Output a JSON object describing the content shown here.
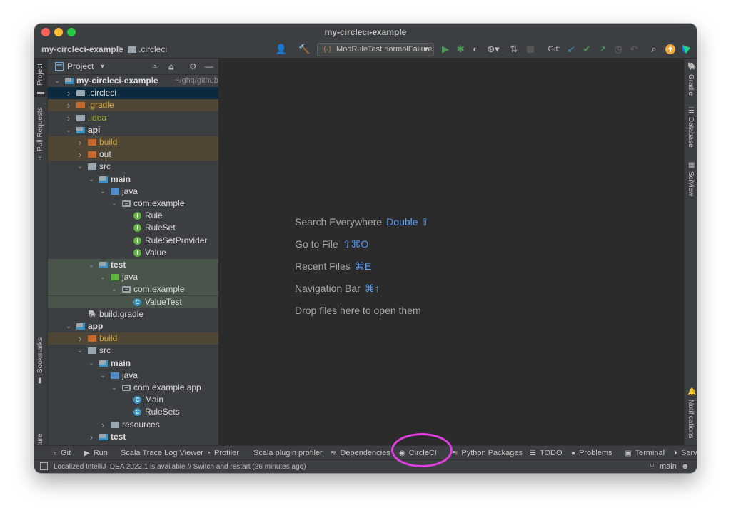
{
  "window": {
    "title": "my-circleci-example"
  },
  "toolbar": {
    "breadcrumb_project": "my-circleci-example",
    "breadcrumb_folder": ".circleci",
    "run_config": "ModRuleTest.normalFailure",
    "git_label": "Git:"
  },
  "left_strip": {
    "top": [
      "Project",
      "Pull Requests"
    ],
    "bottom": [
      "Bookmarks",
      "Structure"
    ]
  },
  "right_strip": {
    "top": [
      "Gradle",
      "Database",
      "SciView"
    ],
    "bottom": [
      "Notifications"
    ]
  },
  "project_panel": {
    "title": "Project",
    "tree": [
      {
        "label": "my-circleci-example",
        "suffix": "~/ghq/github.c",
        "depth": 0,
        "expanded": true,
        "icon": "module-folder-icon",
        "color": "#dcdcdc",
        "bold": true,
        "bg": ""
      },
      {
        "label": ".circleci",
        "depth": 1,
        "expanded": false,
        "icon": "folder-icon",
        "color": "#dcdcdc",
        "bg": "#0d293e"
      },
      {
        "label": ".gradle",
        "depth": 1,
        "expanded": false,
        "icon": "excluded-folder-icon",
        "color": "#d4a73b",
        "bg": "#4f4636"
      },
      {
        "label": ".idea",
        "depth": 1,
        "expanded": false,
        "icon": "folder-icon",
        "color": "#a1a531",
        "bg": ""
      },
      {
        "label": "api",
        "depth": 1,
        "expanded": true,
        "icon": "module-folder-icon",
        "color": "#dcdcdc",
        "bold": true,
        "bg": ""
      },
      {
        "label": "build",
        "depth": 2,
        "expanded": false,
        "icon": "excluded-folder-icon",
        "color": "#d4a73b",
        "bg": "#4f4636"
      },
      {
        "label": "out",
        "depth": 2,
        "expanded": false,
        "icon": "excluded-folder-icon",
        "color": "#dcdcdc",
        "bg": "#4f4636"
      },
      {
        "label": "src",
        "depth": 2,
        "expanded": true,
        "icon": "folder-icon",
        "color": "#dcdcdc",
        "bg": ""
      },
      {
        "label": "main",
        "depth": 3,
        "expanded": true,
        "icon": "module-folder-icon",
        "color": "#dcdcdc",
        "bold": true,
        "bg": ""
      },
      {
        "label": "java",
        "depth": 4,
        "expanded": true,
        "icon": "source-folder-icon",
        "color": "#dcdcdc",
        "bg": ""
      },
      {
        "label": "com.example",
        "depth": 5,
        "expanded": true,
        "icon": "package-icon",
        "color": "#dcdcdc",
        "bg": ""
      },
      {
        "label": "Rule",
        "depth": 6,
        "leaf": true,
        "icon": "interface-icon",
        "color": "#dcdcdc",
        "bg": ""
      },
      {
        "label": "RuleSet",
        "depth": 6,
        "leaf": true,
        "icon": "interface-icon",
        "color": "#dcdcdc",
        "bg": ""
      },
      {
        "label": "RuleSetProvider",
        "depth": 6,
        "leaf": true,
        "icon": "interface-icon",
        "color": "#dcdcdc",
        "bg": ""
      },
      {
        "label": "Value",
        "depth": 6,
        "leaf": true,
        "icon": "interface-icon",
        "color": "#dcdcdc",
        "bg": ""
      },
      {
        "label": "test",
        "depth": 3,
        "expanded": true,
        "icon": "module-folder-icon",
        "color": "#dcdcdc",
        "bold": true,
        "bg": "#49544a"
      },
      {
        "label": "java",
        "depth": 4,
        "expanded": true,
        "icon": "test-folder-icon",
        "color": "#dcdcdc",
        "bg": "#49544a"
      },
      {
        "label": "com.example",
        "depth": 5,
        "expanded": true,
        "icon": "package-icon",
        "color": "#dcdcdc",
        "bg": "#49544a"
      },
      {
        "label": "ValueTest",
        "depth": 6,
        "leaf": true,
        "icon": "class-icon",
        "color": "#dcdcdc",
        "bg": "#49544a"
      },
      {
        "label": "build.gradle",
        "depth": 2,
        "leaf": true,
        "icon": "gradle-icon",
        "color": "#dcdcdc",
        "bg": ""
      },
      {
        "label": "app",
        "depth": 1,
        "expanded": true,
        "icon": "module-folder-icon",
        "color": "#dcdcdc",
        "bold": true,
        "bg": ""
      },
      {
        "label": "build",
        "depth": 2,
        "expanded": false,
        "icon": "excluded-folder-icon",
        "color": "#d4a73b",
        "bg": "#4f4636"
      },
      {
        "label": "src",
        "depth": 2,
        "expanded": true,
        "icon": "folder-icon",
        "color": "#dcdcdc",
        "bg": ""
      },
      {
        "label": "main",
        "depth": 3,
        "expanded": true,
        "icon": "module-folder-icon",
        "color": "#dcdcdc",
        "bold": true,
        "bg": ""
      },
      {
        "label": "java",
        "depth": 4,
        "expanded": true,
        "icon": "source-folder-icon",
        "color": "#dcdcdc",
        "bg": ""
      },
      {
        "label": "com.example.app",
        "depth": 5,
        "expanded": true,
        "icon": "package-icon",
        "color": "#dcdcdc",
        "bg": ""
      },
      {
        "label": "Main",
        "depth": 6,
        "leaf": true,
        "icon": "class-icon",
        "color": "#dcdcdc",
        "bg": ""
      },
      {
        "label": "RuleSets",
        "depth": 6,
        "leaf": true,
        "icon": "class-icon",
        "color": "#dcdcdc",
        "bg": ""
      },
      {
        "label": "resources",
        "depth": 4,
        "expanded": false,
        "icon": "resources-folder-icon",
        "color": "#dcdcdc",
        "bg": ""
      },
      {
        "label": "test",
        "depth": 3,
        "expanded": false,
        "icon": "module-folder-icon",
        "color": "#dcdcdc",
        "bold": true,
        "bg": ""
      }
    ]
  },
  "editor": {
    "hints": [
      {
        "text": "Search Everywhere",
        "shortcut": "Double ⇧"
      },
      {
        "text": "Go to File",
        "shortcut": "⇧⌘O"
      },
      {
        "text": "Recent Files",
        "shortcut": "⌘E"
      },
      {
        "text": "Navigation Bar",
        "shortcut": "⌘↑"
      },
      {
        "text": "Drop files here to open them",
        "shortcut": ""
      }
    ]
  },
  "bottom_tools": [
    {
      "label": "Git",
      "icon": "git-branch-icon"
    },
    {
      "label": "Run",
      "icon": "play-icon"
    },
    {
      "label": "Scala Trace Log Viewer",
      "icon": ""
    },
    {
      "label": "Profiler",
      "icon": "profiler-icon"
    },
    {
      "label": "Scala plugin profiler",
      "icon": ""
    },
    {
      "label": "Dependencies",
      "icon": "layers-icon"
    },
    {
      "label": "CircleCI",
      "icon": "circleci-icon"
    },
    {
      "label": "Python Packages",
      "icon": "layers-icon"
    },
    {
      "label": "TODO",
      "icon": "list-icon"
    },
    {
      "label": "Problems",
      "icon": "warning-icon"
    },
    {
      "label": "Terminal",
      "icon": "terminal-icon"
    },
    {
      "label": "Serv",
      "icon": "services-icon"
    }
  ],
  "status": {
    "message": "Localized IntelliJ IDEA 2022.1 is available // Switch and restart (26 minutes ago)",
    "branch": "main"
  },
  "colors": {
    "highlight_ring": "#e040e0",
    "shortcut_blue": "#589df6",
    "excluded_orange": "#d4a73b",
    "selection_blue": "#0d293e"
  }
}
